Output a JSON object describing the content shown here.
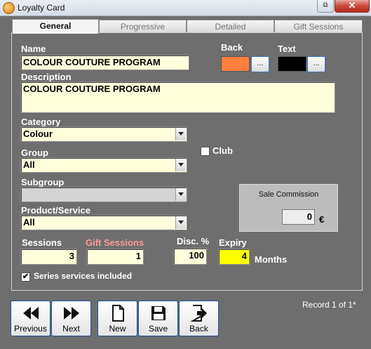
{
  "window": {
    "title": "Loyalty Card",
    "close_label": "✕",
    "restore_label": "⧉"
  },
  "tabs": [
    {
      "label": "General",
      "active": true
    },
    {
      "label": "Progressive",
      "active": false
    },
    {
      "label": "Detailed",
      "active": false
    },
    {
      "label": "Gift Sessions",
      "active": false
    }
  ],
  "form": {
    "name_label": "Name",
    "name_value": "COLOUR COUTURE PROGRAM",
    "back_label": "Back",
    "back_color": "#ff7f3e",
    "text_label": "Text",
    "text_color": "#000000",
    "picker_label": "...",
    "description_label": "Description",
    "description_value": "COLOUR COUTURE PROGRAM",
    "category_label": "Category",
    "category_value": "Colour",
    "group_label": "Group",
    "group_value": "All",
    "club_label": "Club",
    "club_checked": false,
    "subgroup_label": "Subgroup",
    "subgroup_value": "",
    "product_label": "Product/Service",
    "product_value": "All",
    "sessions_label": "Sessions",
    "sessions_value": "3",
    "gift_sessions_label": "Gift Sessions",
    "gift_sessions_value": "1",
    "disc_label": "Disc. %",
    "disc_value": "100",
    "expiry_label": "Expiry",
    "expiry_value": "4",
    "months_label": "Months",
    "series_label": "Series services included",
    "series_checked": true,
    "commission_label": "Sale Commission",
    "commission_value": "0",
    "currency_symbol": "€"
  },
  "toolbar": {
    "previous_label": "Previous",
    "next_label": "Next",
    "new_label": "New",
    "save_label": "Save",
    "back_label": "Back"
  },
  "status": {
    "record_text": "Record 1 of 1*"
  },
  "colors": {
    "background": "#6e6e6e",
    "field_bg": "#ffffdc",
    "expiry_bg": "#ffff00",
    "gift_label": "#ff9a9a"
  }
}
